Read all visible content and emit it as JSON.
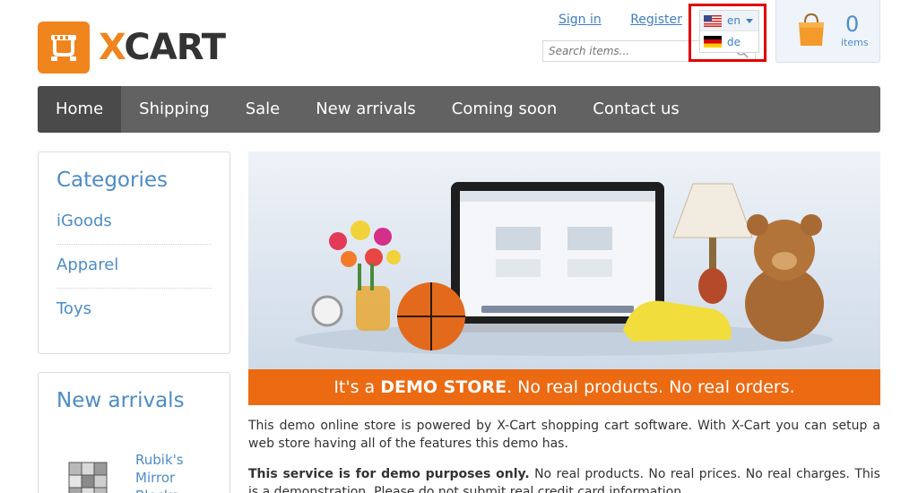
{
  "logo": {
    "x_letter": "X",
    "cart_word": "CART"
  },
  "header": {
    "sign_in": "Sign in",
    "register": "Register",
    "search_placeholder": "Search items..."
  },
  "language": {
    "options": [
      {
        "code": "en",
        "flag": "us-flag-icon",
        "selected": true
      },
      {
        "code": "de",
        "flag": "germany-flag-icon",
        "selected": false
      }
    ]
  },
  "cart": {
    "count": "0",
    "label": "items"
  },
  "nav": {
    "items": [
      "Home",
      "Shipping",
      "Sale",
      "New arrivals",
      "Coming soon",
      "Contact us"
    ],
    "active": "Home"
  },
  "categories": {
    "title": "Categories",
    "items": [
      "iGoods",
      "Apparel",
      "Toys"
    ]
  },
  "new_arrivals": {
    "title": "New arrivals",
    "product_name": "Rubik's Mirror Blocks"
  },
  "banner": {
    "lead": "It's a",
    "highlight": "DEMO STORE",
    "tail": ". No real products. No real orders."
  },
  "content": {
    "paragraph1": "This demo online store is powered by X-Cart shopping cart software. With X-Cart you can setup a web store having all of the features this demo has.",
    "paragraph2_bold": "This service is for demo purposes only.",
    "paragraph2_rest": " No real products. No real prices. No real charges. This is a demonstration. Please do not submit real credit card information."
  },
  "colors": {
    "brand_orange": "#f0841d",
    "link_blue": "#3f7fc1",
    "nav_gray": "#626262",
    "highlight_red": "#e00000"
  }
}
